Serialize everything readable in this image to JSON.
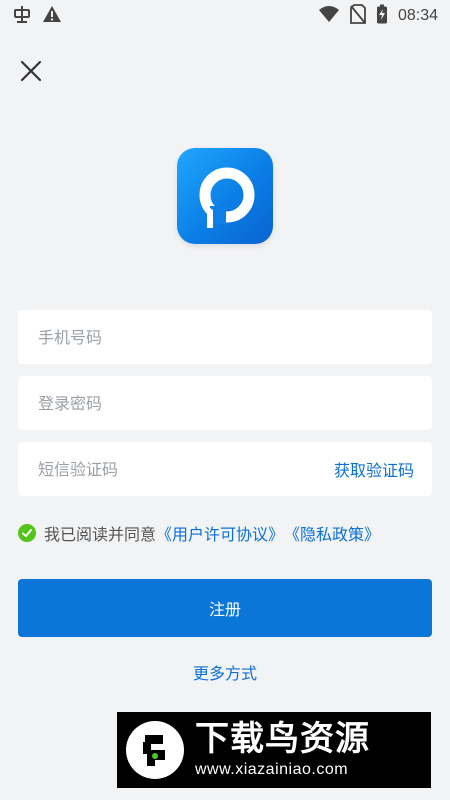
{
  "status_bar": {
    "time": "08:34",
    "icons": [
      "bug-icon",
      "warning-icon",
      "wifi-icon",
      "no-sim-icon",
      "battery-charging-icon"
    ]
  },
  "header": {
    "close_icon": "close-icon"
  },
  "app": {
    "logo_icon": "app-logo-icon",
    "brand_colors": [
      "#20a7ff",
      "#0a63d1"
    ]
  },
  "form": {
    "phone_placeholder": "手机号码",
    "password_placeholder": "登录密码",
    "sms_placeholder": "短信验证码",
    "get_code_label": "获取验证码"
  },
  "agreement": {
    "checked": true,
    "prefix": "我已阅读并同意",
    "user_license": "《用户许可协议》",
    "privacy_policy": "《隐私政策》",
    "check_color": "#52c41a"
  },
  "actions": {
    "register_label": "注册",
    "register_color": "#0c76d8",
    "more_options_label": "更多方式",
    "link_color": "#0b6fd4"
  },
  "watermark": {
    "title": "下载鸟资源",
    "url": "www.xiazainiao.com"
  }
}
